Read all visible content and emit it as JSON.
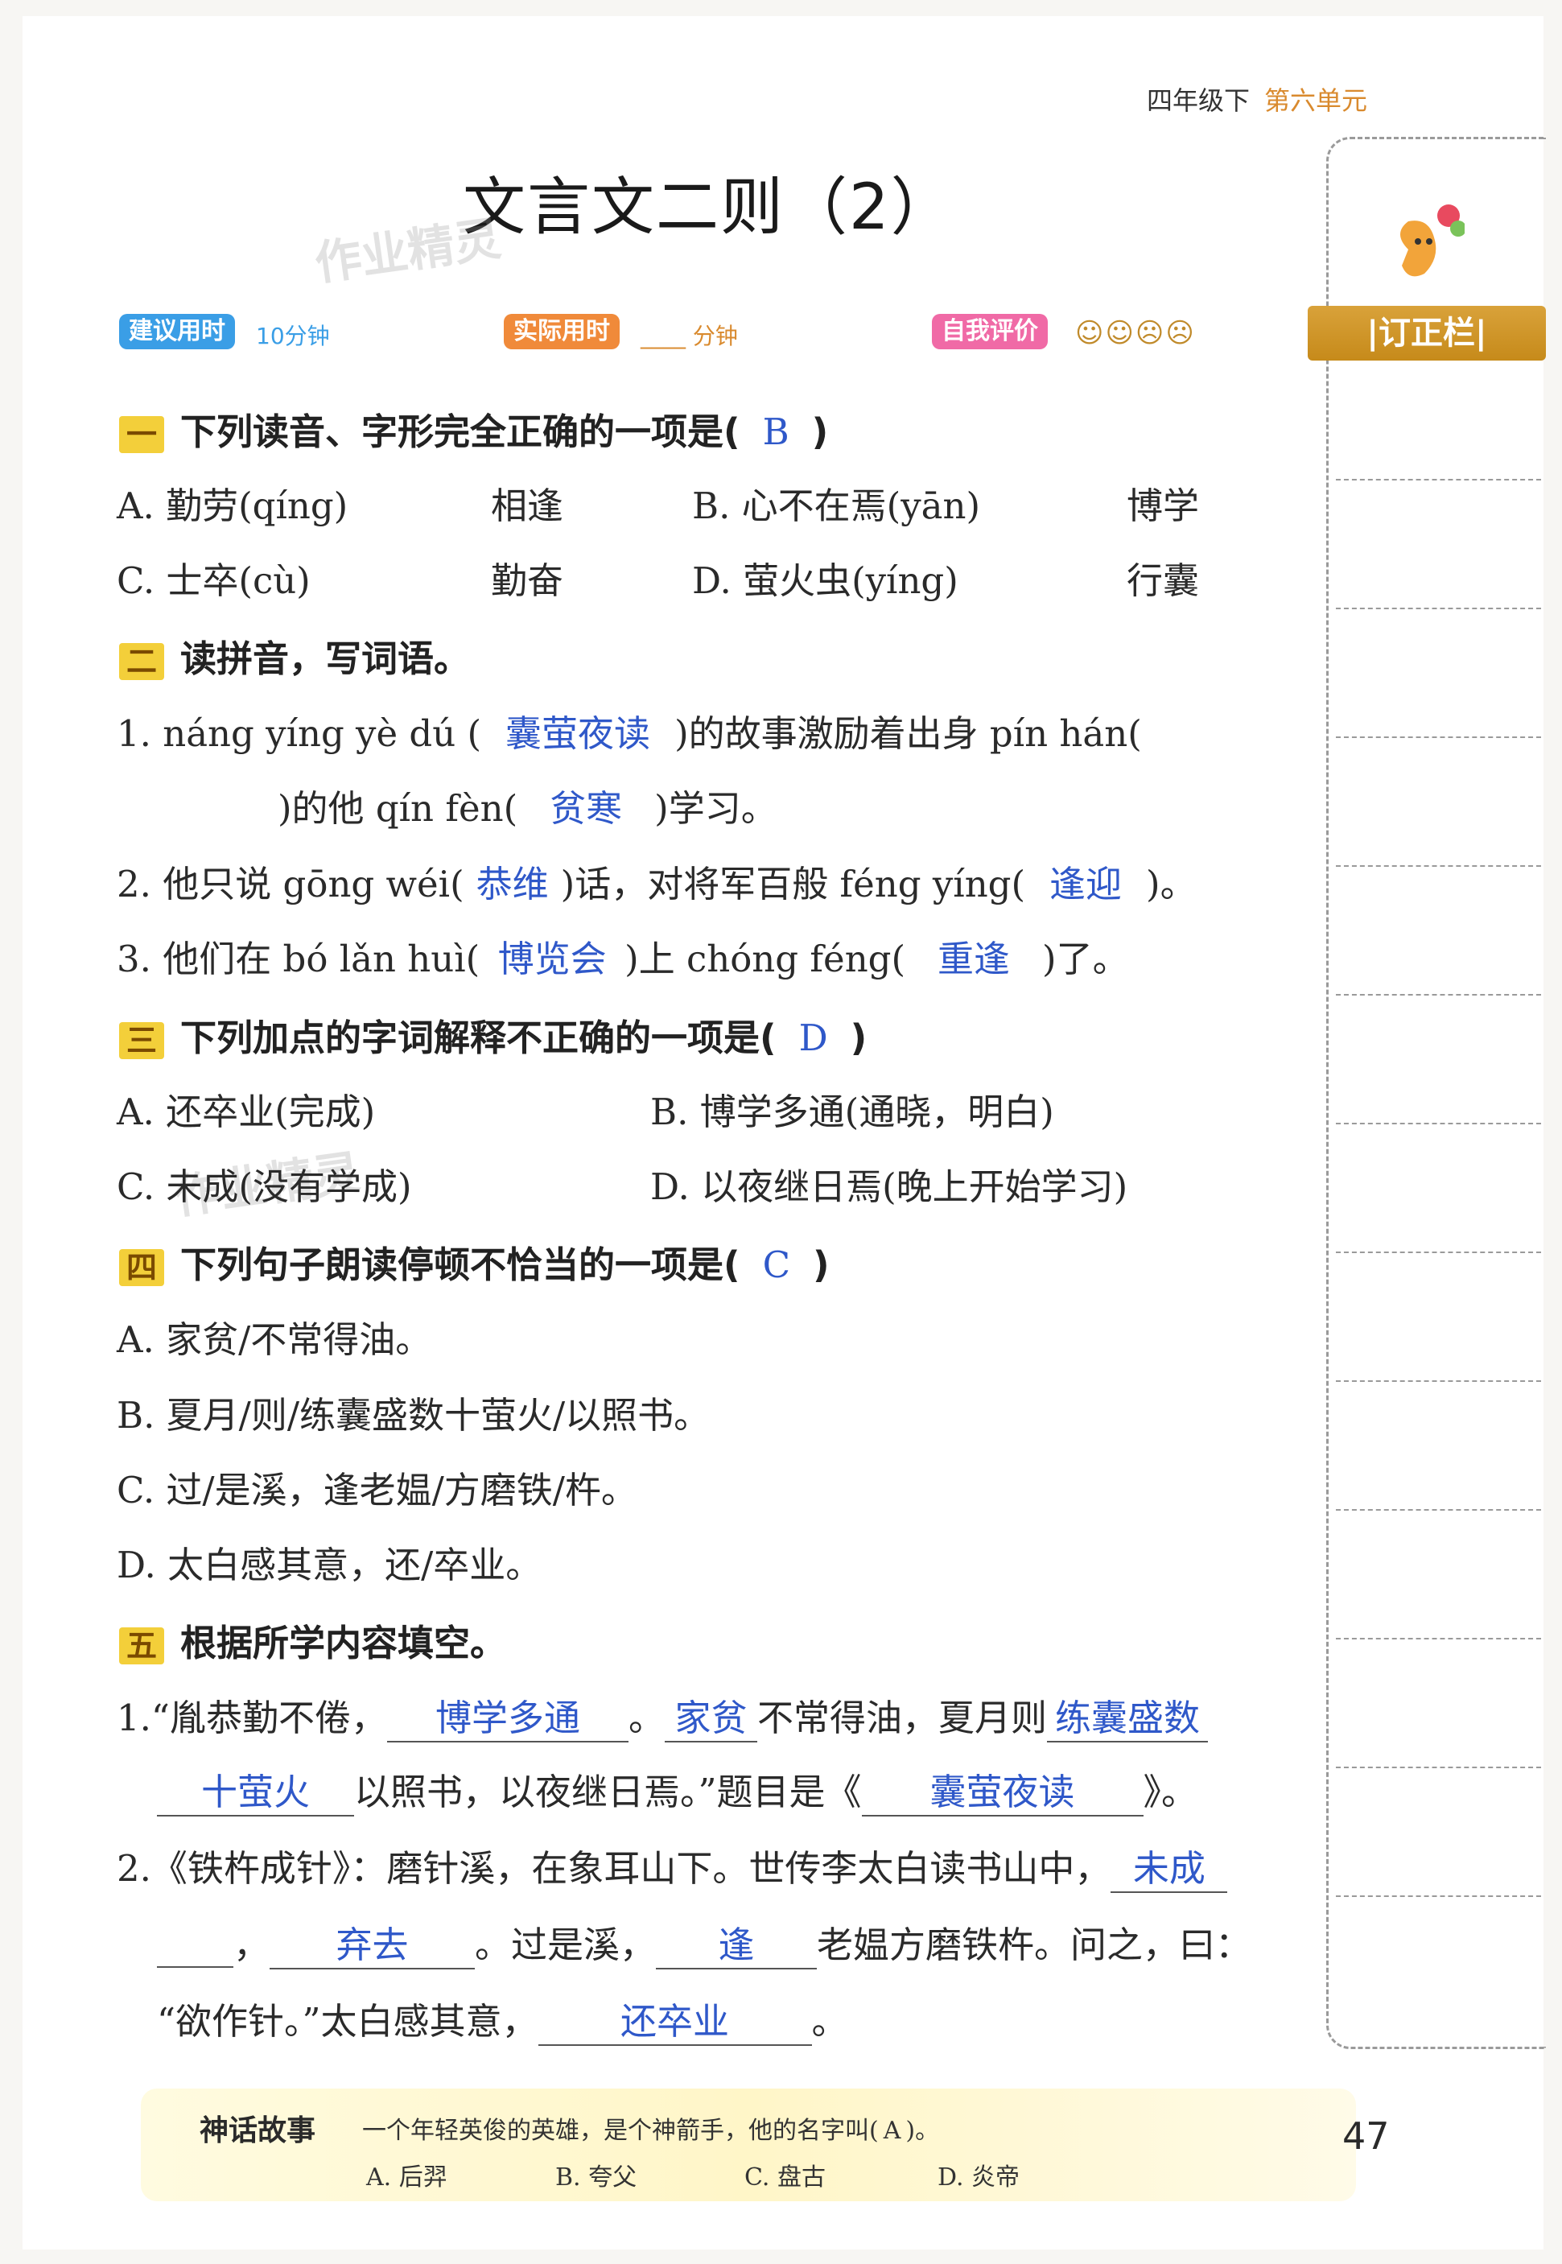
{
  "header": {
    "grade": "四年级下",
    "unit": "第六单元"
  },
  "title": "文言文二则（2）",
  "watermark": "作业精灵",
  "meta": {
    "suggest_label": "建议用时",
    "suggest_value": "10分钟",
    "actual_label": "实际用时",
    "actual_value": "____ 分钟",
    "self_label": "自我评价",
    "faces": "☺☺☹☹"
  },
  "side": {
    "label": "|订正栏|"
  },
  "s1": {
    "num": "一",
    "title": "下列读音、字形完全正确的一项是(",
    "answer": "B",
    "close": ")",
    "a1": "A. 勤劳(qíng)",
    "a2": "相逢",
    "b1": "B. 心不在焉(yān)",
    "b2": "博学",
    "c1": "C. 士卒(cù)",
    "c2": "勤奋",
    "d1": "D. 萤火虫(yíng)",
    "d2": "行囊"
  },
  "s2": {
    "num": "二",
    "title": "读拼音，写词语。",
    "l1a": "1. náng yíng yè dú (",
    "l1ans": "囊萤夜读",
    "l1b": ")的故事激励着出身 pín hán(",
    "l2b": ")的他 qín fèn(",
    "l2ans": "贫寒",
    "l2c": ")学习。",
    "l3a": "2. 他只说 gōng wéi(",
    "l3ans1": "恭维",
    "l3b": ")话，对将军百般 féng yíng(",
    "l3ans2": "逢迎",
    "l3c": ")。",
    "l4a": "3. 他们在 bó lǎn huì(",
    "l4ans1": "博览会",
    "l4b": ")上 chóng féng(",
    "l4ans2": "重逢",
    "l4c": ")了。"
  },
  "s3": {
    "num": "三",
    "title": "下列加点的字词解释不正确的一项是(",
    "answer": "D",
    "close": ")",
    "a": "A. 还卒业(完成)",
    "b": "B. 博学多通(通晓，明白)",
    "c": "C. 未成(没有学成)",
    "d": "D. 以夜继日焉(晚上开始学习)"
  },
  "s4": {
    "num": "四",
    "title": "下列句子朗读停顿不恰当的一项是(",
    "answer": "C",
    "close": ")",
    "a": "A. 家贫/不常得油。",
    "b": "B. 夏月/则/练囊盛数十萤火/以照书。",
    "c": "C. 过/是溪，逢老媪/方磨铁/杵。",
    "d": "D. 太白感其意，还/卒业。"
  },
  "s5": {
    "num": "五",
    "title": "根据所学内容填空。",
    "p1a": "1.“胤恭勤不倦，",
    "p1ans1": "博学多通",
    "p1b": "。",
    "p1ans2": "家贫",
    "p1c": "不常得油，夏月则",
    "p1ans3": "练囊盛数",
    "p2ans": "十萤火",
    "p2a": "以照书，以夜继日焉。”题目是《",
    "p2ans2": "囊萤夜读",
    "p2b": "》。",
    "p3a": "2.《铁杵成针》：磨针溪，在象耳山下。世传李太白读书山中，",
    "p3ans": "未成",
    "p4a": "，",
    "p4ans1": "弃去",
    "p4b": "。过是溪，",
    "p4ans2": "逢",
    "p4c": "老媪方磨铁杵。问之，曰：",
    "p5a": "“欲作针。”太白感其意，",
    "p5ans": "还卒业",
    "p5b": "。"
  },
  "footer": {
    "title": "神话故事",
    "question": "一个年轻英俊的英雄，是个神箭手，他的名字叫(",
    "answer": "A",
    "close": ")。",
    "a": "A. 后羿",
    "b": "B. 夸父",
    "c": "C. 盘古",
    "d": "D. 炎帝"
  },
  "page_number": "47"
}
